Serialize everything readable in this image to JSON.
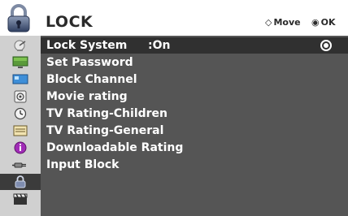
{
  "header": {
    "title": "LOCK",
    "icon": "lock-icon",
    "hints": [
      {
        "icon": "four-way-arrow-icon",
        "glyph": "◇",
        "label": "Move"
      },
      {
        "icon": "ok-button-icon",
        "glyph": "◉",
        "label": "OK"
      }
    ]
  },
  "side_icons": [
    {
      "name": "satellite-dish-icon"
    },
    {
      "name": "picture-icon"
    },
    {
      "name": "screen-icon"
    },
    {
      "name": "audio-icon"
    },
    {
      "name": "clock-icon"
    },
    {
      "name": "option-icon"
    },
    {
      "name": "info-icon"
    },
    {
      "name": "input-plug-icon"
    },
    {
      "name": "lock-icon",
      "active": true
    },
    {
      "name": "clapperboard-icon"
    }
  ],
  "menu": {
    "items": [
      {
        "label": "Lock System",
        "value": ":On",
        "selected": true
      },
      {
        "label": "Set Password"
      },
      {
        "label": "Block Channel"
      },
      {
        "label": "Movie rating"
      },
      {
        "label": "TV Rating-Children"
      },
      {
        "label": "TV Rating-General"
      },
      {
        "label": "Downloadable Rating"
      },
      {
        "label": "Input Block"
      }
    ]
  },
  "colors": {
    "panel": "#555555",
    "selected_row": "#303030",
    "icon_column": "#d0d0d0",
    "active_icon_bg": "#3b3b3b"
  }
}
